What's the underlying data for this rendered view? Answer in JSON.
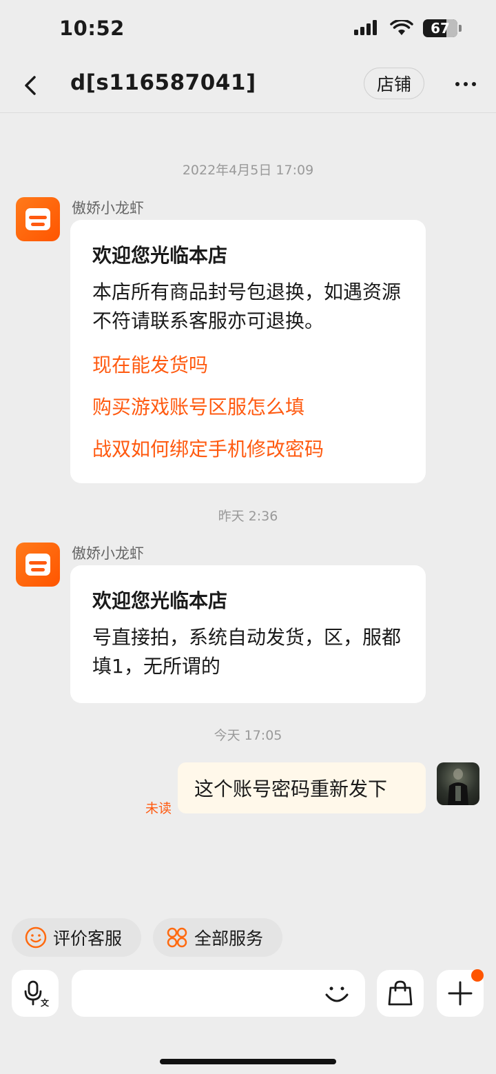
{
  "status_bar": {
    "time": "10:52",
    "battery": "67"
  },
  "header": {
    "title": "d[s116587041]",
    "store_label": "店铺"
  },
  "messages": [
    {
      "timestamp": "2022年4月5日 17:09",
      "sender": "傲娇小龙虾",
      "title": "欢迎您光临本店",
      "body": "本店所有商品封号包退换，如遇资源不符请联系客服亦可退换。",
      "links": [
        "现在能发货吗",
        "购买游戏账号区服怎么填",
        "战双如何绑定手机修改密码"
      ]
    },
    {
      "timestamp": "昨天 2:36",
      "sender": "傲娇小龙虾",
      "title": "欢迎您光临本店",
      "body": "号直接拍，系统自动发货，区，服都填1，无所谓的"
    },
    {
      "timestamp": "今天 17:05",
      "text": "这个账号密码重新发下",
      "status": "未读"
    }
  ],
  "quick_actions": [
    {
      "label": "评价客服",
      "icon": "smile-icon"
    },
    {
      "label": "全部服务",
      "icon": "grid-icon"
    }
  ],
  "colors": {
    "accent": "#ff5a10",
    "brand_orange": "#ff6a10",
    "background": "#ededed",
    "my_bubble": "#fff8ea"
  }
}
